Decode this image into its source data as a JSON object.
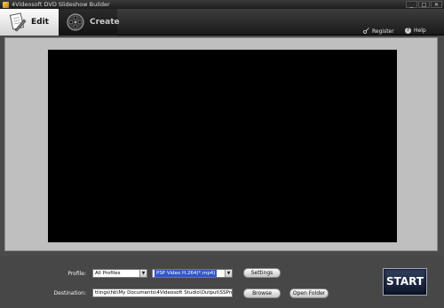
{
  "window": {
    "title": "4Videosoft DVD Slideshow Builder",
    "controls": {
      "minimize": "_",
      "restore": "□",
      "close": "✕"
    }
  },
  "toolbar": {
    "tabs": [
      {
        "label": "Edit",
        "icon": "edit-document-icon",
        "active": true
      },
      {
        "label": "Create",
        "icon": "film-reel-icon",
        "active": false
      }
    ],
    "register_label": "Register",
    "help_label": "Help"
  },
  "bottom": {
    "profile_label": "Profile:",
    "profile_value": "All Profiles",
    "format_value": "PSP Video H.264(*.mp4)",
    "settings_label": "Settings",
    "destination_label": "Destination:",
    "destination_value": "ttings\\hb\\My Documents\\4Videosoft Studio\\Output\\SSProject.mp4",
    "browse_label": "Browse",
    "open_folder_label": "Open Folder",
    "start_label": "START"
  },
  "colors": {
    "format_highlight": "#2f58c4",
    "panel_bg": "#bfbfbf",
    "preview_bg": "#000000"
  }
}
